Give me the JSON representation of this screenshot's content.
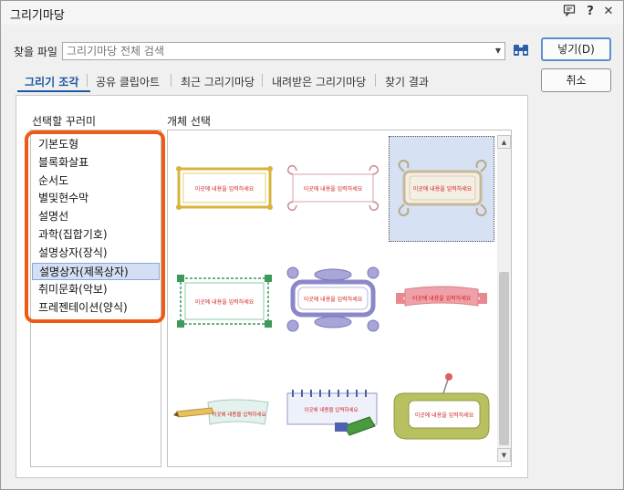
{
  "window": {
    "title": "그리기마당",
    "help_icon": "?",
    "close_icon": "✕"
  },
  "search": {
    "label": "찾을 파일",
    "placeholder": "그리기마당 전체 검색"
  },
  "buttons": {
    "insert": "넣기(D)",
    "cancel": "취소"
  },
  "tabs": [
    {
      "label": "그리기 조각"
    },
    {
      "label": "공유 클립아트"
    },
    {
      "label": "최근 그리기마당"
    },
    {
      "label": "내려받은 그리기마당"
    },
    {
      "label": "찾기 결과"
    }
  ],
  "categories": {
    "label": "선택할 꾸러미",
    "items": [
      {
        "label": "기본도형"
      },
      {
        "label": "블록화살표"
      },
      {
        "label": "순서도"
      },
      {
        "label": "별및현수막"
      },
      {
        "label": "설명선"
      },
      {
        "label": "과학(집합기호)"
      },
      {
        "label": "설명상자(장식)"
      },
      {
        "label": "설명상자(제목상자)"
      },
      {
        "label": "취미문화(악보)"
      },
      {
        "label": "프레젠테이션(양식)"
      }
    ],
    "selected": "설명상자(제목상자)"
  },
  "objects": {
    "label": "개체 선택",
    "thumb_text": "이곳에 내용을 입력하세요",
    "colors": {
      "gold": "#d8b43c",
      "pink": "#d8a0a8",
      "tan": "#c8b898",
      "green": "#3c9a5a",
      "purple": "#8a88c8",
      "ribbon": "#f0a0a8",
      "text": "#d02020"
    }
  },
  "colors": {
    "accent": "#1a58a0",
    "highlight": "#f05a14",
    "selection": "#d4dff3"
  }
}
